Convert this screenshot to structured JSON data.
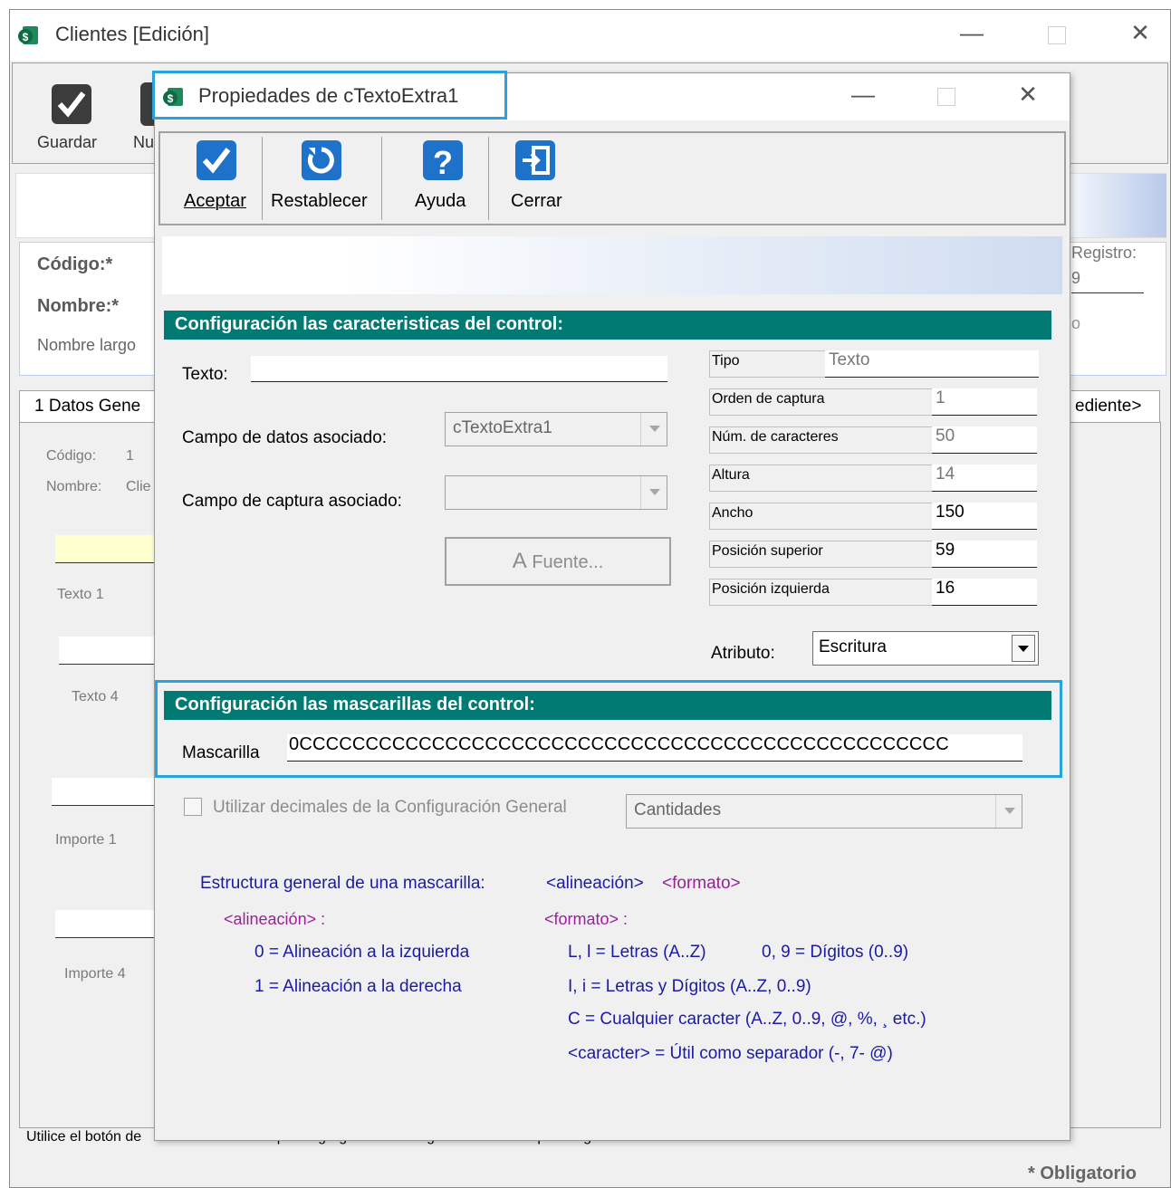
{
  "parent": {
    "title": "Clientes [Edición]",
    "toolbar": {
      "save_label": "Guardar",
      "new_label": "Nu"
    },
    "fields": {
      "code_label": "Código:*",
      "name_label": "Nombre:*",
      "long_name_label": "Nombre largo"
    },
    "registro_label": "Registro:",
    "registro_value": "9",
    "side_text": "o",
    "tab_datos": "1 Datos Gene",
    "tab_pendiente": "ediente>",
    "info": {
      "code_label": "Código:",
      "code_value": "1",
      "name_label": "Nombre:",
      "name_value": "Clie"
    },
    "canvas_labels": {
      "texto1": "Texto 1",
      "texto4": "Texto 4",
      "importe1": "Importe 1",
      "importe4": "Importe 4"
    },
    "status_text_left": "Utilice el botón de",
    "status_text_right": "recho del mouse para agregar controles gráficos. Ctrl+F6 para regresar a modo Normal.",
    "required_note": "* Obligatorio"
  },
  "dialog": {
    "title": "Propiedades de cTextoExtra1",
    "toolbar": {
      "accept": "Aceptar",
      "reset": "Restablecer",
      "help": "Ayuda",
      "close": "Cerrar"
    },
    "section1_title": "Configuración las caracteristicas del control:",
    "texto_label": "Texto:",
    "texto_value": "",
    "campo_datos_label": "Campo de datos asociado:",
    "campo_datos_value": "cTextoExtra1",
    "campo_captura_label": "Campo de captura asociado:",
    "campo_captura_value": "",
    "fuente_label": "Fuente...",
    "props": [
      {
        "label": "Tipo",
        "value": "Texto"
      },
      {
        "label": "Orden de captura",
        "value": "1"
      },
      {
        "label": "Núm. de caracteres",
        "value": "50"
      },
      {
        "label": "Altura",
        "value": "14"
      },
      {
        "label": "Ancho",
        "value": "150"
      },
      {
        "label": "Posición superior",
        "value": "59"
      },
      {
        "label": "Posición izquierda",
        "value": "16"
      }
    ],
    "atributo_label": "Atributo:",
    "atributo_value": "Escritura",
    "section2_title": "Configuración las mascarillas del control:",
    "mascarilla_label": "Mascarilla",
    "mascarilla_value": "0CCCCCCCCCCCCCCCCCCCCCCCCCCCCCCCCCCCCCCCCCCCCCCCCC",
    "decimales_label": "Utilizar decimales de la Configuración General",
    "cantidades_value": "Cantidades",
    "help": {
      "estructura": "Estructura general de una mascarilla:",
      "alineacion_tag": "<alineación>",
      "formato_tag": "<formato>",
      "alineacion_hdr": "<alineación> :",
      "formato_hdr": "<formato> :",
      "align0": "0 = Alineación a la izquierda",
      "align1": "1 = Alineación a la derecha",
      "fmt1a": "L, l = Letras (A..Z)",
      "fmt1b": "0, 9 = Dígitos (0..9)",
      "fmt2": "I, i = Letras y Dígitos (A..Z, 0..9)",
      "fmt3": "C = Cualquier caracter (A..Z, 0..9, @, %, ¸ etc.)",
      "fmt4": "<caracter> = Útil como separador (-, 7- @)"
    }
  },
  "colors": {
    "section_header": "#007a72",
    "highlight": "#29a3dd",
    "help_blue": "#1a1aa6",
    "help_purple": "#9b1f9b"
  }
}
